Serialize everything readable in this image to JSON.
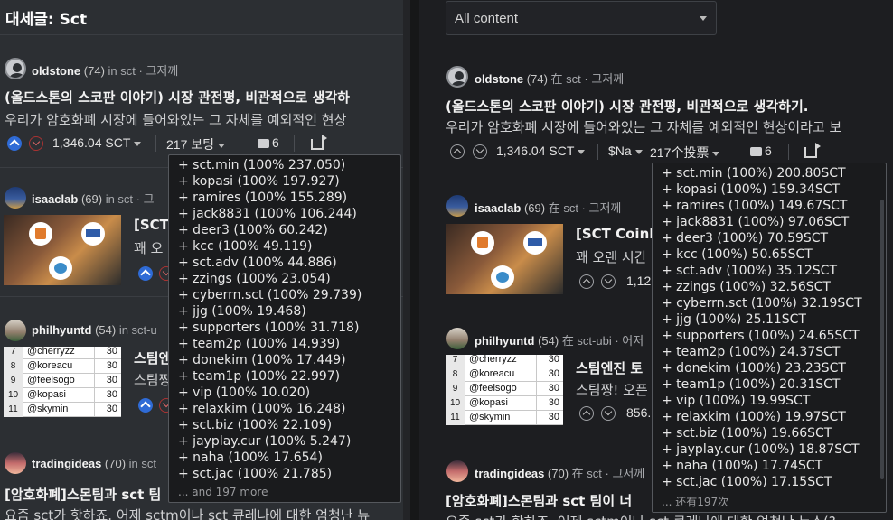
{
  "left": {
    "title": "대세글: Sct",
    "posts": [
      {
        "author": "oldstone",
        "rep": "(74)",
        "meta": "in sct · 그저께",
        "title": "(올드스톤의 스코판 이야기) 시장 관전평, 비관적으로 생각하",
        "body": "우리가 암호화폐 시장에 들어와있는 그 자체를 예외적인 현상",
        "payout": "1,346.04 SCT",
        "votes": "217 보팅",
        "comments": "6"
      },
      {
        "author": "isaaclab",
        "rep": "(69)",
        "meta": "in sct · 그",
        "title": "[SCT",
        "body": "꽤 오"
      },
      {
        "author": "philhyuntd",
        "rep": "(54)",
        "meta": "in sct-u",
        "title": "스팀엔",
        "body": "스팀짱"
      },
      {
        "author": "tradingideas",
        "rep": "(70)",
        "meta": "in sct",
        "title": "[암호화폐]스몬팀과 sct 팀",
        "body": "요즘 sct가 핫하죠. 어제 sctm이나 sct 큐레나에 대한 엄청난 뉴"
      }
    ],
    "vote_popup": {
      "voters": [
        "+ sct.min (100% 237.050)",
        "+ kopasi (100% 197.927)",
        "+ ramires (100% 155.289)",
        "+ jack8831 (100% 106.244)",
        "+ deer3 (100% 60.242)",
        "+ kcc (100% 49.119)",
        "+ sct.adv (100% 44.886)",
        "+ zzings (100% 23.054)",
        "+ cyberrn.sct (100% 29.739)",
        "+ jjg (100% 19.468)",
        "+ supporters (100% 31.718)",
        "+ team2p (100% 14.939)",
        "+ donekim (100% 17.449)",
        "+ team1p (100% 22.997)",
        "+ vip (100% 10.020)",
        "+ relaxkim (100% 16.248)",
        "+ sct.biz (100% 22.109)",
        "+ jayplay.cur (100% 5.247)",
        "+ naha (100% 17.654)",
        "+ sct.jac (100% 21.785)"
      ],
      "more": "... and 197 more"
    }
  },
  "right": {
    "filter": "All content",
    "posts": [
      {
        "author": "oldstone",
        "rep": "(74)",
        "meta": "在 sct · 그저께",
        "title": "(올드스톤의 스코판 이야기) 시장 관전평, 비관적으로 생각하기.",
        "body": "우리가 암호화폐 시장에 들어와있는 그 자체를 예외적인 현상이라고 보",
        "payout": "1,346.04 SCT",
        "currency": "$Na",
        "votes": "217个投票",
        "comments": "6"
      },
      {
        "author": "isaaclab",
        "rep": "(69)",
        "meta": "在 sct · 그저께",
        "title": "[SCT CoinN",
        "body": "꽤 오랜 시간",
        "payout": "1,12"
      },
      {
        "author": "philhyuntd",
        "rep": "(54)",
        "meta": "在 sct-ubi · 어저",
        "title": "스팀엔진 토",
        "body": "스팀짱! 오픈",
        "payout": "856."
      },
      {
        "author": "tradingideas",
        "rep": "(70)",
        "meta": "在 sct · 그저께",
        "title": "[암호화폐]스몬팀과 sct 팀이 너",
        "body": "요즘 sct가 핫하죠. 어제 sctm이나 sct 큐레나에 대한 엄청난 뉴스(?"
      }
    ],
    "vote_popup": {
      "voters": [
        "+ sct.min (100%) 200.80SCT",
        "+ kopasi (100%) 159.34SCT",
        "+ ramires (100%) 149.67SCT",
        "+ jack8831 (100%) 97.06SCT",
        "+ deer3 (100%) 70.59SCT",
        "+ kcc (100%) 50.65SCT",
        "+ sct.adv (100%) 35.12SCT",
        "+ zzings (100%) 32.56SCT",
        "+ cyberrn.sct (100%) 32.19SCT",
        "+ jjg (100%) 25.11SCT",
        "+ supporters (100%) 24.65SCT",
        "+ team2p (100%) 24.37SCT",
        "+ donekim (100%) 23.23SCT",
        "+ team1p (100%) 20.31SCT",
        "+ vip (100%) 19.99SCT",
        "+ relaxkim (100%) 19.97SCT",
        "+ sct.biz (100%) 19.66SCT",
        "+ jayplay.cur (100%) 18.87SCT",
        "+ naha (100%) 17.74SCT",
        "+ sct.jac (100%) 17.15SCT"
      ],
      "more": "... 还有197次"
    }
  },
  "thumb_table": {
    "rows": [
      {
        "n": "7",
        "name": "@cherryzz",
        "v": "30"
      },
      {
        "n": "8",
        "name": "@koreacu",
        "v": "30"
      },
      {
        "n": "9",
        "name": "@feelsogo",
        "v": "30"
      },
      {
        "n": "10",
        "name": "@kopasi",
        "v": "30"
      },
      {
        "n": "11",
        "name": "@skymin",
        "v": "30"
      }
    ]
  },
  "icons": [
    "user-icon",
    "upvote-icon",
    "downvote-icon",
    "comment-icon",
    "reblog-icon",
    "caret-down-icon"
  ],
  "colors": {
    "upvote_active": "#2f6bd6",
    "downvote": "#d66666",
    "pane_bg_left": "#2c2f33",
    "pane_bg_right": "#1d1e21"
  }
}
